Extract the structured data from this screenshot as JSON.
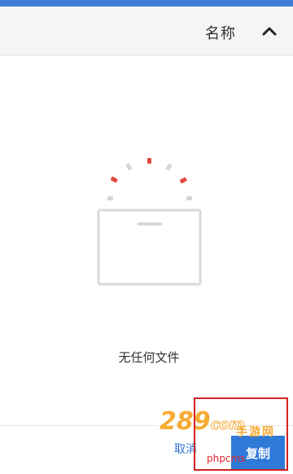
{
  "header": {
    "sort_label": "名称",
    "sort_icon": "chevron-up-icon"
  },
  "empty_state": {
    "message": "无任何文件",
    "icon": "empty-folder-icon"
  },
  "actions": {
    "cancel_label": "取消",
    "copy_label": "复制"
  },
  "watermark": {
    "logo_text": "289",
    "logo_suffix": "com",
    "sub_text": "手游网",
    "php_text": "phpcms"
  },
  "colors": {
    "accent": "#2f7ad8",
    "highlight": "#d22222",
    "spinner_red": "#e0483e",
    "spinner_gray": "#d6d6d6"
  }
}
